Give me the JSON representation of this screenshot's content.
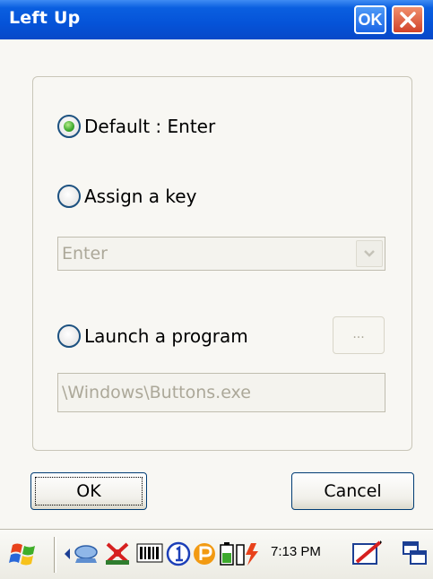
{
  "window": {
    "title": "Left Up",
    "ok_title_label": "OK"
  },
  "options": {
    "default": {
      "label": "Default : Enter",
      "checked": true
    },
    "assign": {
      "label": "Assign a key",
      "checked": false
    },
    "launch": {
      "label": "Launch a program",
      "checked": false
    }
  },
  "key_combo": {
    "value": "Enter"
  },
  "browse_button": {
    "label": "..."
  },
  "program_path": {
    "value": "\\Windows\\Buttons.exe"
  },
  "buttons": {
    "ok": "OK",
    "cancel": "Cancel"
  },
  "taskbar": {
    "clock": "7:13 PM",
    "icons": [
      "start-icon",
      "arrow-left-icon",
      "network-icon",
      "bluetooth-icon",
      "barcode-icon",
      "one-circle-icon",
      "p-circle-icon",
      "battery-icon",
      "input-panel-icon",
      "windows-switcher-icon"
    ]
  },
  "colors": {
    "title_bar": "#0553d8",
    "radio_checked": "#3da92d",
    "disabled_text": "#aca899"
  }
}
